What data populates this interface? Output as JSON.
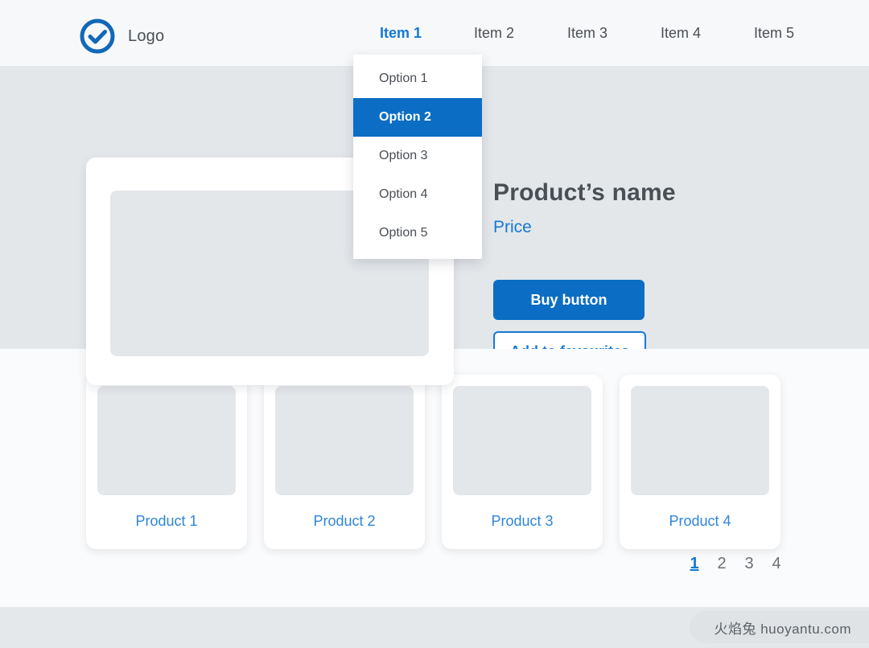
{
  "header": {
    "logo_icon": "check-circle-icon",
    "brand_name": "Logo",
    "nav_items": [
      {
        "label": "Item 1",
        "active": true
      },
      {
        "label": "Item 2",
        "active": false
      },
      {
        "label": "Item 3",
        "active": false
      },
      {
        "label": "Item 4",
        "active": false
      },
      {
        "label": "Item 5",
        "active": false
      }
    ]
  },
  "dropdown": {
    "items": [
      {
        "label": "Option 1",
        "selected": false
      },
      {
        "label": "Option 2",
        "selected": true
      },
      {
        "label": "Option 3",
        "selected": false
      },
      {
        "label": "Option 4",
        "selected": false
      },
      {
        "label": "Option 5",
        "selected": false
      }
    ]
  },
  "hero": {
    "product_name": "Product’s name",
    "price_label": "Price",
    "buy_button": "Buy button",
    "favourites_button": "Add to favourites"
  },
  "grid": {
    "cards": [
      {
        "label": "Product 1"
      },
      {
        "label": "Product 2"
      },
      {
        "label": "Product 3"
      },
      {
        "label": "Product 4"
      }
    ]
  },
  "pagination": {
    "pages": [
      {
        "label": "1",
        "active": true
      },
      {
        "label": "2",
        "active": false
      },
      {
        "label": "3",
        "active": false
      },
      {
        "label": "4",
        "active": false
      }
    ]
  },
  "footer": {
    "watermark": "火焰兔 huoyantu.com"
  },
  "colors": {
    "accent_blue": "#1479d4",
    "selected_blue": "#0b6ec4",
    "text_dark": "#4a4f55",
    "hero_bg": "#e4e7ea",
    "page_bg": "#fafbfc",
    "header_bg": "#f7f8f9",
    "footer_bg": "#e5e8ea"
  }
}
